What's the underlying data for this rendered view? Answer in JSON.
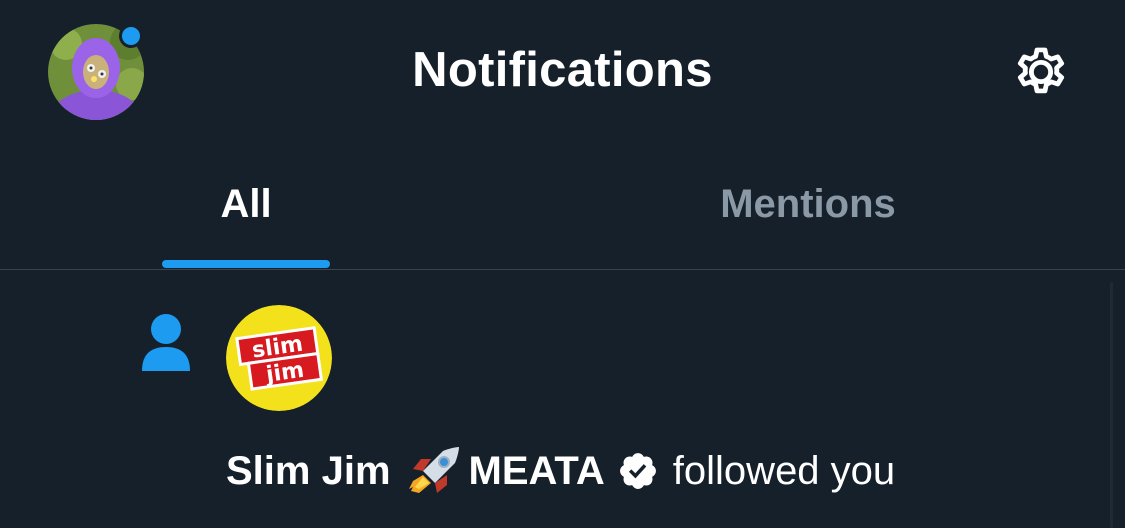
{
  "header": {
    "title": "Notifications",
    "avatar_icon": "profile-avatar-purple-hood",
    "unread_indicator_color": "#1d9bf0",
    "settings_icon": "gear-icon"
  },
  "tabs": [
    {
      "label": "All",
      "active": true
    },
    {
      "label": "Mentions",
      "active": false
    }
  ],
  "colors": {
    "background": "#15202b",
    "accent": "#1d9bf0",
    "inactive_tab": "#8b98a5",
    "divider": "#38444d"
  },
  "notifications": [
    {
      "type": "follow",
      "type_icon": "person-icon",
      "actor_avatar": "slim-jim-logo",
      "actor_avatar_text": "slim jim",
      "actor_name_part1": "Slim Jim",
      "actor_name_emoji": "rocket-emoji",
      "actor_name_part2": "MEATA",
      "verified": true,
      "action_text": "followed you"
    }
  ]
}
